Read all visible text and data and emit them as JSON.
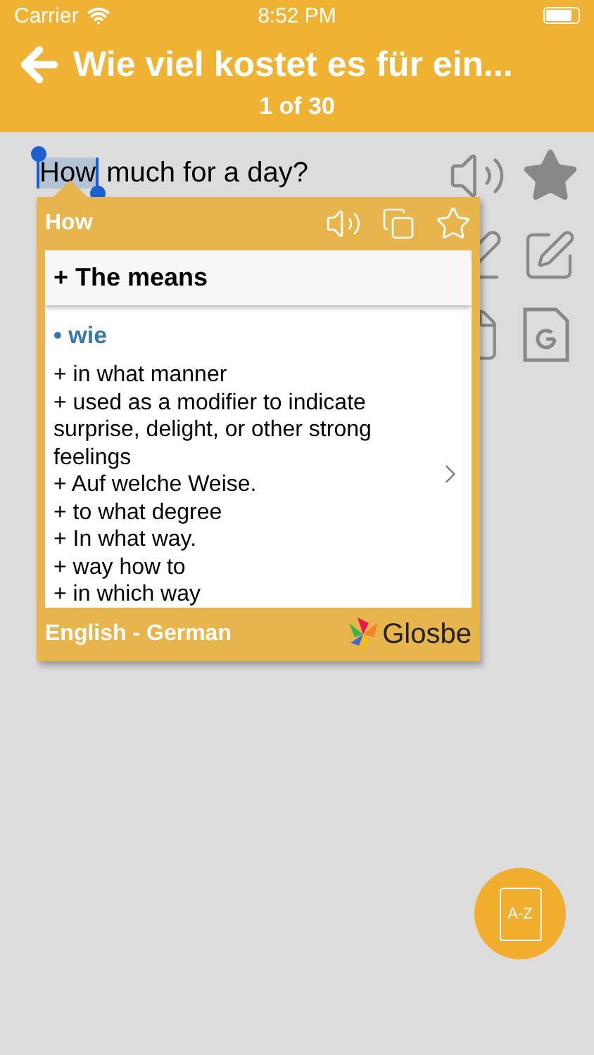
{
  "status_bar": {
    "carrier": "Carrier",
    "time": "8:52 PM"
  },
  "header": {
    "title": "Wie viel kostet es für ein...",
    "counter": "1 of 30"
  },
  "sentence": {
    "selected_word": "How",
    "rest": " much for a day?"
  },
  "actions": {
    "starred": true
  },
  "popup": {
    "word": "How",
    "starred": false,
    "section": "+ The means",
    "headword": "• wie",
    "lines": [
      "+ in what manner",
      "+ used as a modifier to indicate surprise, delight, or other strong feelings",
      "+ Auf welche Weise.",
      "+ to what degree",
      "+ In what way.",
      "+ way how to",
      "+ in which way"
    ],
    "language_pair": "English - German",
    "brand": "Glosbe"
  },
  "fab": {
    "label": "A-Z"
  }
}
